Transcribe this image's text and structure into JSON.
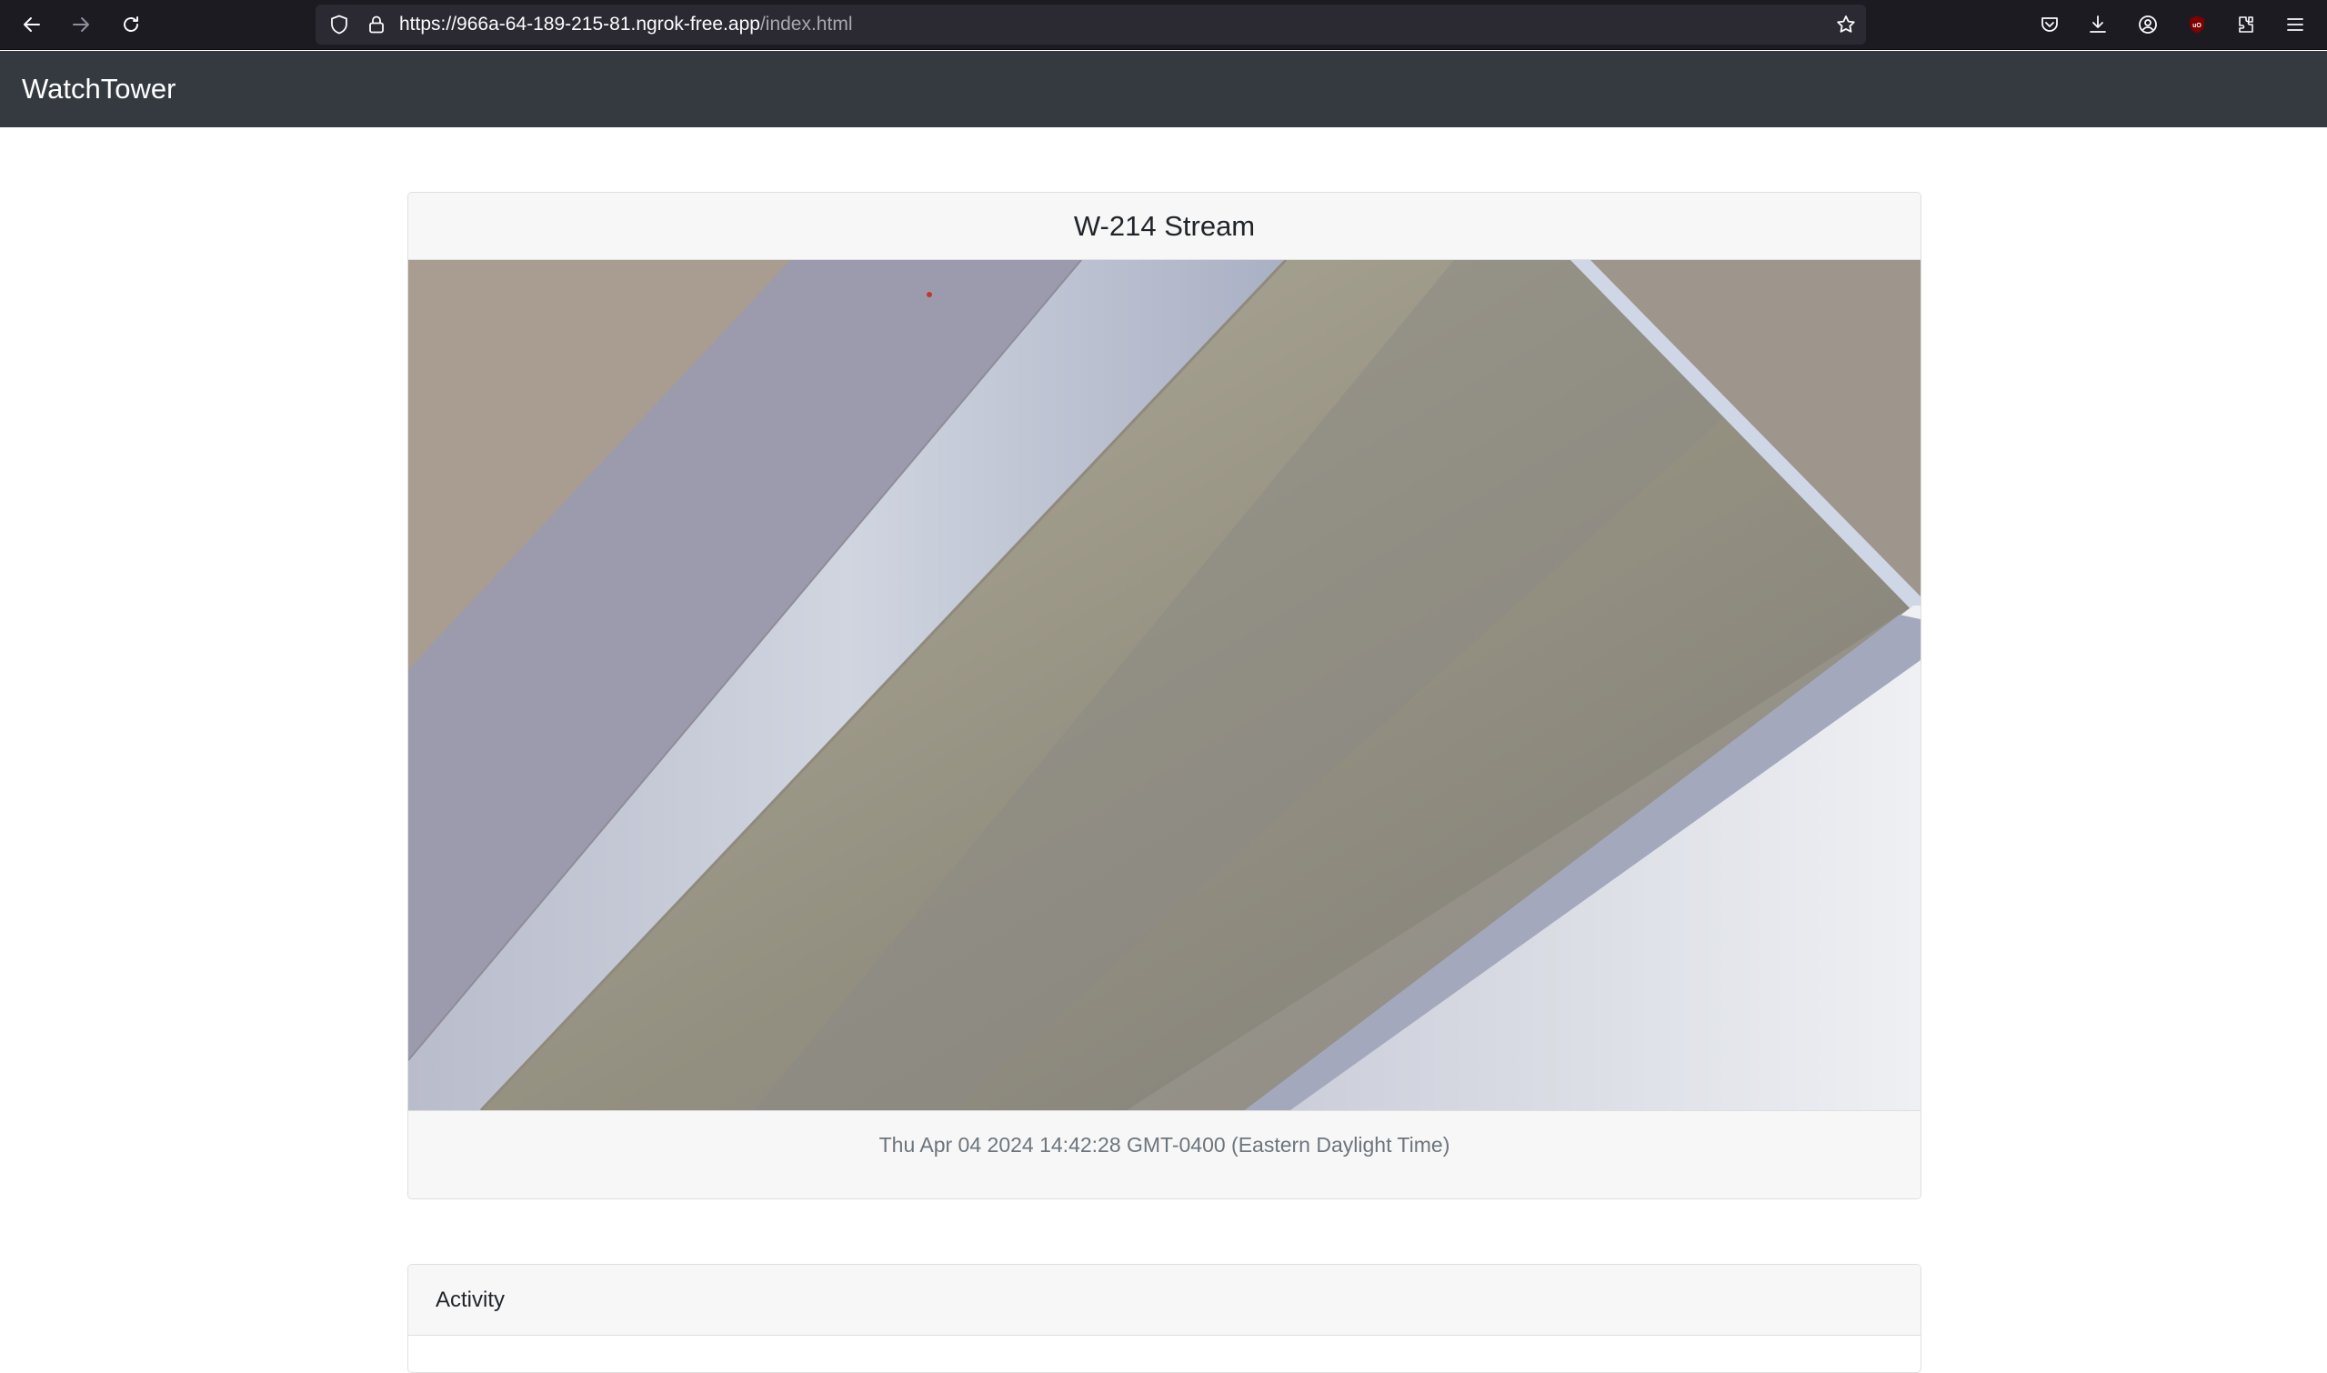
{
  "browser": {
    "url_host": "https://966a-64-189-215-81.ngrok-free.app",
    "url_path": "/index.html",
    "icons": [
      "back-arrow-icon",
      "forward-arrow-icon",
      "reload-icon",
      "shield-icon",
      "lock-icon",
      "star-icon",
      "pocket-icon",
      "download-icon",
      "account-icon",
      "ublock-icon",
      "extensions-icon",
      "menu-icon"
    ]
  },
  "navbar": {
    "brand": "WatchTower"
  },
  "stream": {
    "title": "W-214 Stream",
    "timestamp": "Thu Apr 04 2024 14:42:28 GMT-0400 (Eastern Daylight Time)"
  },
  "activity": {
    "title": "Activity"
  },
  "colors": {
    "browser_bg": "#1c1b22",
    "urlbar_bg": "#2b2a33",
    "navbar_bg": "#343a40",
    "card_header_bg": "#f7f7f7",
    "timestamp_color": "#6c757d"
  }
}
